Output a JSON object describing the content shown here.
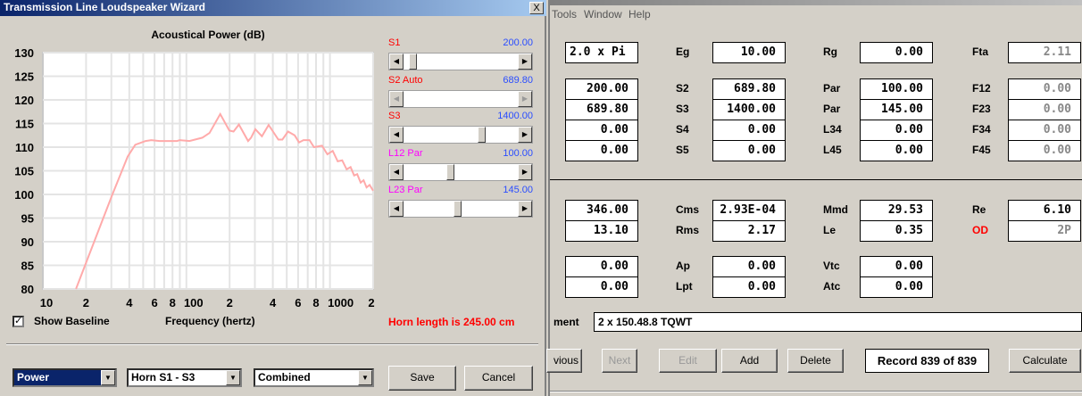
{
  "right_window": {
    "menu": [
      "Tools",
      "Window",
      "Help"
    ],
    "rows_top": [
      {
        "c1": "2.0 x Pi",
        "l2": "Eg",
        "c2": "10.00",
        "l3": "Rg",
        "c3": "0.00",
        "l4": "Fta",
        "c4": "2.11"
      },
      {
        "c1": "200.00",
        "l2": "S2",
        "c2": "689.80",
        "l3": "Par",
        "c3": "100.00",
        "l4": "F12",
        "c4": "0.00"
      },
      {
        "c1": "689.80",
        "l2": "S3",
        "c2": "1400.00",
        "l3": "Par",
        "c3": "145.00",
        "l4": "F23",
        "c4": "0.00"
      },
      {
        "c1": "0.00",
        "l2": "S4",
        "c2": "0.00",
        "l3": "L34",
        "c3": "0.00",
        "l4": "F34",
        "c4": "0.00"
      },
      {
        "c1": "0.00",
        "l2": "S5",
        "c2": "0.00",
        "l3": "L45",
        "c3": "0.00",
        "l4": "F45",
        "c4": "0.00"
      }
    ],
    "rows_bottom": [
      {
        "c1": "346.00",
        "l2": "Cms",
        "c2": "2.93E-04",
        "l3": "Mmd",
        "c3": "29.53",
        "l4": "Re",
        "c4": "6.10"
      },
      {
        "c1": "13.10",
        "l2": "Rms",
        "c2": "2.17",
        "l3": "Le",
        "c3": "0.35",
        "l4": "OD",
        "c4": "2P"
      },
      {
        "c1": "0.00",
        "l2": "Ap",
        "c2": "0.00",
        "l3": "Vtc",
        "c3": "0.00"
      },
      {
        "c1": "0.00",
        "l2": "Lpt",
        "c2": "0.00",
        "l3": "Atc",
        "c3": "0.00"
      }
    ],
    "comment_label": "ment",
    "comment_value": "2 x 150.48.8 TQWT",
    "buttons": {
      "previous": "vious",
      "next": "Next",
      "edit": "Edit",
      "add": "Add",
      "delete": "Delete",
      "calculate": "Calculate"
    },
    "record": "Record 839 of 839"
  },
  "wizard": {
    "title": "Transmission Line Loudspeaker Wizard",
    "close": "X",
    "sliders": [
      {
        "label": "S1",
        "value": "200.00",
        "color": "#ff0000",
        "position": 0.05
      },
      {
        "label": "S2  Auto",
        "value": "689.80",
        "color": "#ff0000",
        "position": null
      },
      {
        "label": "S3",
        "value": "1400.00",
        "color": "#ff0000",
        "position": 0.7
      },
      {
        "label": "L12  Par",
        "value": "100.00",
        "color": "#ff00ff",
        "position": 0.4
      },
      {
        "label": "L23  Par",
        "value": "145.00",
        "color": "#ff00ff",
        "position": 0.47
      }
    ],
    "show_baseline": "Show Baseline",
    "show_baseline_checked": true,
    "horn_length": "Horn length is 245.00 cm",
    "combo_mode": "Power",
    "combo_section": "Horn S1 - S3",
    "combo_type": "Combined",
    "save": "Save",
    "cancel": "Cancel"
  },
  "chart_data": {
    "type": "line",
    "title": "Acoustical Power (dB)",
    "xlabel": "Frequency (hertz)",
    "ylabel": "",
    "xscale": "log",
    "xlim": [
      10,
      2000
    ],
    "ylim": [
      80,
      130
    ],
    "yticks": [
      "130",
      "125",
      "120",
      "115",
      "110",
      "105",
      "100",
      "95",
      "90",
      "85",
      "80"
    ],
    "xticks": [
      {
        "v": 10,
        "t": "10"
      },
      {
        "v": 20,
        "t": "2"
      },
      {
        "v": 40,
        "t": "4"
      },
      {
        "v": 60,
        "t": "6"
      },
      {
        "v": 80,
        "t": "8"
      },
      {
        "v": 100,
        "t": "100"
      },
      {
        "v": 200,
        "t": "2"
      },
      {
        "v": 400,
        "t": "4"
      },
      {
        "v": 600,
        "t": "6"
      },
      {
        "v": 800,
        "t": "8"
      },
      {
        "v": 1000,
        "t": "1000"
      },
      {
        "v": 2000,
        "t": "2"
      }
    ],
    "grid": true,
    "color": "#ffaaaa",
    "series": [
      {
        "name": "Power",
        "x": [
          17,
          30.5,
          39,
          44,
          52,
          57,
          65,
          86,
          90,
          105,
          129,
          145,
          172,
          199,
          213,
          232,
          269,
          282,
          302,
          336,
          374,
          437,
          466,
          510,
          568,
          609,
          654,
          720,
          774,
          881,
          960,
          1045,
          1133,
          1217,
          1308,
          1393,
          1475,
          1548,
          1637,
          1717,
          1799,
          1888,
          2000
        ],
        "y": [
          80,
          100,
          108,
          110.5,
          111.3,
          111.5,
          111.3,
          111.3,
          111.5,
          111.3,
          112,
          113,
          117,
          113.5,
          113.3,
          114.8,
          111.3,
          112,
          113.8,
          112.3,
          114.7,
          111.6,
          111.6,
          113.3,
          112.5,
          111,
          111.5,
          111.5,
          110,
          110.3,
          108.5,
          109.2,
          107,
          107.2,
          105.3,
          105.8,
          104,
          104.3,
          102.5,
          103,
          101.5,
          102,
          100.8
        ]
      }
    ]
  }
}
